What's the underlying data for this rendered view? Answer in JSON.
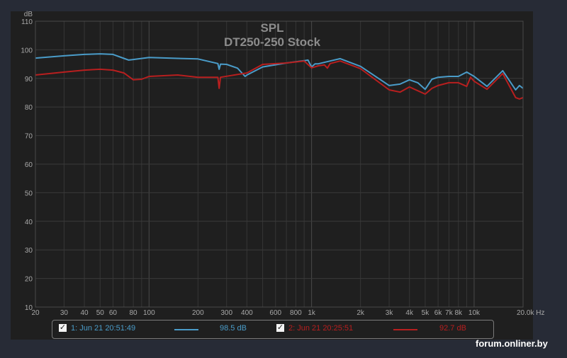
{
  "chart_data": {
    "type": "line",
    "title": "SPL",
    "subtitle": "DT250-250 Stock",
    "ylabel": "dB",
    "xlabel": "Hz",
    "xscale": "log",
    "xlim": [
      20,
      20000
    ],
    "ylim": [
      10,
      110
    ],
    "grid": true,
    "y_ticks": [
      10,
      20,
      30,
      40,
      50,
      60,
      70,
      80,
      90,
      100,
      110
    ],
    "x_ticks": [
      {
        "v": 20,
        "label": "20"
      },
      {
        "v": 30,
        "label": "30"
      },
      {
        "v": 40,
        "label": "40"
      },
      {
        "v": 50,
        "label": "50"
      },
      {
        "v": 60,
        "label": "60"
      },
      {
        "v": 80,
        "label": "80"
      },
      {
        "v": 100,
        "label": "100"
      },
      {
        "v": 200,
        "label": "200"
      },
      {
        "v": 300,
        "label": "300"
      },
      {
        "v": 400,
        "label": "400"
      },
      {
        "v": 600,
        "label": "600"
      },
      {
        "v": 800,
        "label": "800"
      },
      {
        "v": 1000,
        "label": "1k"
      },
      {
        "v": 2000,
        "label": "2k"
      },
      {
        "v": 3000,
        "label": "3k"
      },
      {
        "v": 4000,
        "label": "4k"
      },
      {
        "v": 5000,
        "label": "5k"
      },
      {
        "v": 6000,
        "label": "6k"
      },
      {
        "v": 7000,
        "label": "7k"
      },
      {
        "v": 8000,
        "label": "8k"
      },
      {
        "v": 10000,
        "label": "10k"
      },
      {
        "v": 20000,
        "label": "20.0k Hz"
      }
    ],
    "series": [
      {
        "name": "1: Jun 21 20:51:49",
        "level": "98.5 dB",
        "color": "#4a9cc9",
        "x": [
          20,
          30,
          40,
          50,
          60,
          70,
          75,
          80,
          100,
          150,
          200,
          265,
          270,
          275,
          300,
          350,
          390,
          400,
          500,
          700,
          900,
          950,
          1000,
          1050,
          1100,
          1300,
          1500,
          2000,
          3000,
          3500,
          4000,
          4500,
          5000,
          5500,
          6000,
          7000,
          8000,
          9000,
          10000,
          12000,
          15000,
          18000,
          19000,
          20000
        ],
        "y": [
          97.1,
          97.9,
          98.4,
          98.6,
          98.4,
          97,
          96.4,
          96.6,
          97.3,
          97,
          96.8,
          95.2,
          93.2,
          95,
          94.9,
          93.6,
          90.7,
          91.2,
          94,
          95.4,
          96.2,
          96.4,
          94,
          95.1,
          95.1,
          96.1,
          96.9,
          94.2,
          87.5,
          88,
          89.5,
          88.5,
          86.2,
          89.7,
          90.4,
          90.7,
          90.7,
          92.2,
          90.7,
          87.2,
          92.7,
          86,
          87.5,
          86.5
        ]
      },
      {
        "name": "2: Jun 21 20:25:51",
        "level": "92.7 dB",
        "color": "#b81f1f",
        "x": [
          20,
          30,
          40,
          50,
          60,
          70,
          80,
          90,
          100,
          150,
          200,
          265,
          270,
          275,
          400,
          500,
          700,
          900,
          1000,
          1100,
          1200,
          1250,
          1300,
          1500,
          2000,
          3000,
          3500,
          4000,
          5000,
          5500,
          6000,
          7000,
          8000,
          9000,
          9500,
          10000,
          12000,
          15000,
          18000,
          19000,
          20000
        ],
        "y": [
          91.2,
          92.2,
          92.9,
          93.2,
          92.9,
          91.9,
          89.5,
          89.7,
          90.7,
          91.2,
          90.4,
          90.4,
          86.5,
          90.4,
          91.9,
          94.9,
          95.4,
          96.1,
          93.7,
          94.4,
          94.7,
          93.6,
          95.2,
          96.1,
          93.4,
          86,
          85.2,
          87,
          84.5,
          86.5,
          87.5,
          88.5,
          88.5,
          87.2,
          90.4,
          89,
          86.2,
          91.7,
          83.3,
          82.8,
          83.3
        ]
      }
    ]
  },
  "watermark": "forum.onliner.by",
  "legend": {
    "check": "✓"
  }
}
